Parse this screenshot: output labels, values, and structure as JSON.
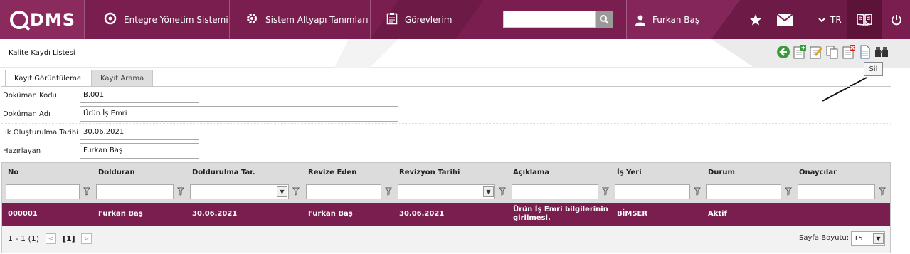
{
  "app": {
    "logo_text": "DMS",
    "nav": [
      {
        "label": "Entegre Yönetim Sistemi",
        "icon": "circle-logo-icon"
      },
      {
        "label": "Sistem Altyapı Tanımları",
        "icon": "gear-icon"
      },
      {
        "label": "Görevlerim",
        "icon": "clipboard-icon"
      }
    ],
    "search": {
      "value": "",
      "placeholder": ""
    },
    "user_name": "Furkan Baş",
    "language": "TR",
    "colors": {
      "brand": "#7a1e4f",
      "brand_dark": "#5d1238"
    }
  },
  "page": {
    "title": "Kalite Kaydı Listesi",
    "tooltip": "Sil",
    "tabs": [
      {
        "label": "Kayıt Görüntüleme",
        "active": true
      },
      {
        "label": "Kayıt Arama",
        "active": false
      }
    ]
  },
  "form": {
    "fields": [
      {
        "label": "Doküman Kodu",
        "value": "B.001"
      },
      {
        "label": "Doküman Adı",
        "value": "Ürün İş Emri"
      },
      {
        "label": "İlk Oluşturulma Tarihi",
        "value": "30.06.2021"
      },
      {
        "label": "Hazırlayan",
        "value": "Furkan Baş"
      }
    ]
  },
  "grid": {
    "columns": [
      "No",
      "Dolduran",
      "Doldurulma Tar.",
      "Revize Eden",
      "Revizyon Tarihi",
      "Açıklama",
      "İş Yeri",
      "Durum",
      "Onaycılar"
    ],
    "rows": [
      {
        "no": "000001",
        "dolduran": "Furkan Baş",
        "doldurulma_tar": "30.06.2021",
        "revize_eden": "Furkan Baş",
        "revizyon_tarihi": "30.06.2021",
        "aciklama": "Ürün İş Emri bilgilerinin girilmesi.",
        "is_yeri": "BİMSER",
        "durum": "Aktif",
        "onaycilar": ""
      }
    ],
    "pager": {
      "range": "1 - 1 (1)",
      "current_page": "[1]",
      "page_size_label": "Sayfa Boyutu:",
      "page_size": "15"
    }
  }
}
